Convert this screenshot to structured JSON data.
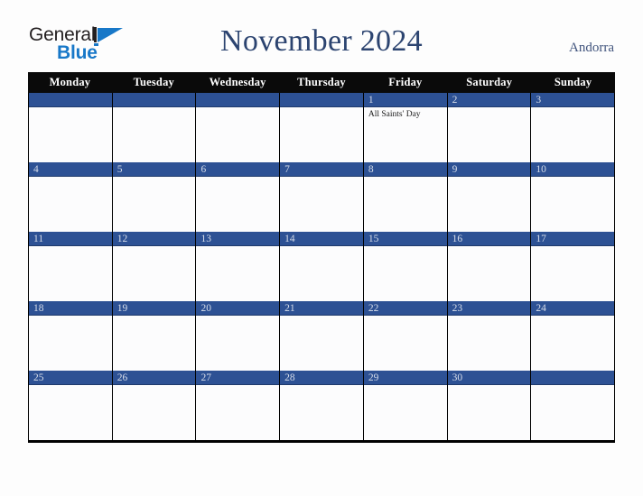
{
  "logo": {
    "word_one": "General",
    "word_two": "Blue",
    "triangle_icon": "triangle-icon",
    "brand_blue": "#1878c8",
    "brand_black": "#231f20"
  },
  "header": {
    "title": "November 2024",
    "country": "Andorra",
    "title_color": "#2c4470",
    "country_color": "#41547d"
  },
  "calendar": {
    "weekdays": [
      "Monday",
      "Tuesday",
      "Wednesday",
      "Thursday",
      "Friday",
      "Saturday",
      "Sunday"
    ],
    "header_bg": "#0a0a0a",
    "header_fg": "#ffffff",
    "banner_bg": "#2d5194",
    "banner_fg": "#d7dde9",
    "cell_bg": "#fcfcfd",
    "grid_line": "#000000",
    "weeks": [
      {
        "days": [
          {
            "date": "",
            "events": []
          },
          {
            "date": "",
            "events": []
          },
          {
            "date": "",
            "events": []
          },
          {
            "date": "",
            "events": []
          },
          {
            "date": "1",
            "events": [
              "All Saints' Day"
            ]
          },
          {
            "date": "2",
            "events": []
          },
          {
            "date": "3",
            "events": []
          }
        ]
      },
      {
        "days": [
          {
            "date": "4",
            "events": []
          },
          {
            "date": "5",
            "events": []
          },
          {
            "date": "6",
            "events": []
          },
          {
            "date": "7",
            "events": []
          },
          {
            "date": "8",
            "events": []
          },
          {
            "date": "9",
            "events": []
          },
          {
            "date": "10",
            "events": []
          }
        ]
      },
      {
        "days": [
          {
            "date": "11",
            "events": []
          },
          {
            "date": "12",
            "events": []
          },
          {
            "date": "13",
            "events": []
          },
          {
            "date": "14",
            "events": []
          },
          {
            "date": "15",
            "events": []
          },
          {
            "date": "16",
            "events": []
          },
          {
            "date": "17",
            "events": []
          }
        ]
      },
      {
        "days": [
          {
            "date": "18",
            "events": []
          },
          {
            "date": "19",
            "events": []
          },
          {
            "date": "20",
            "events": []
          },
          {
            "date": "21",
            "events": []
          },
          {
            "date": "22",
            "events": []
          },
          {
            "date": "23",
            "events": []
          },
          {
            "date": "24",
            "events": []
          }
        ]
      },
      {
        "days": [
          {
            "date": "25",
            "events": []
          },
          {
            "date": "26",
            "events": []
          },
          {
            "date": "27",
            "events": []
          },
          {
            "date": "28",
            "events": []
          },
          {
            "date": "29",
            "events": []
          },
          {
            "date": "30",
            "events": []
          },
          {
            "date": "",
            "events": []
          }
        ]
      }
    ]
  }
}
